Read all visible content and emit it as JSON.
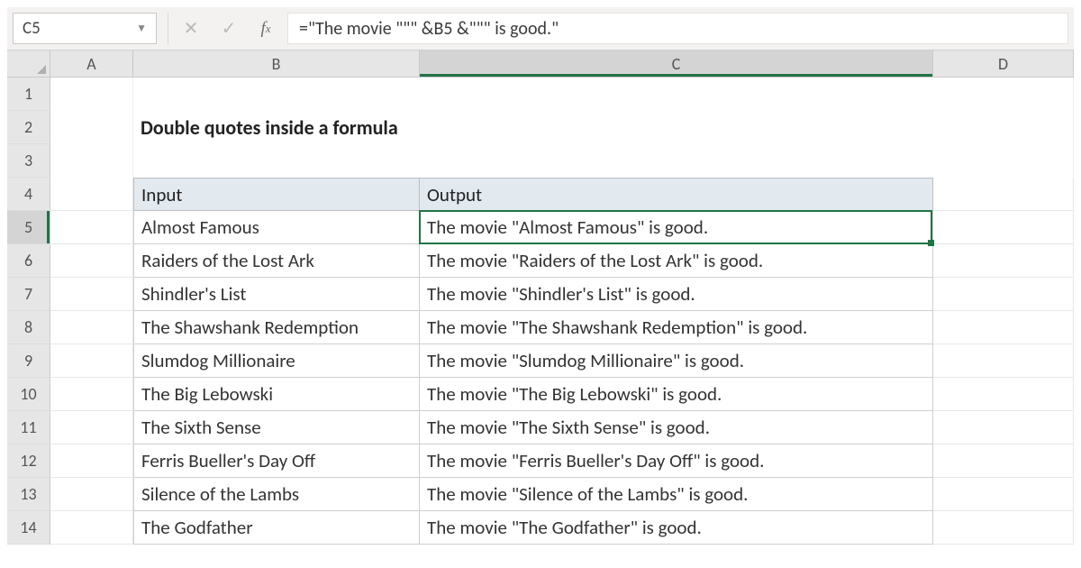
{
  "namebox": {
    "value": "C5"
  },
  "formula": "=\"The movie \"\"\" &B5 &\"\"\" is good.\"",
  "columns": [
    "A",
    "B",
    "C",
    "D"
  ],
  "activeCol": "C",
  "activeRow": "5",
  "title": "Double quotes inside a formula",
  "table": {
    "headers": {
      "input": "Input",
      "output": "Output"
    },
    "rows": [
      {
        "input": "Almost Famous",
        "output": "The movie \"Almost Famous\" is good."
      },
      {
        "input": "Raiders of the Lost Ark",
        "output": "The movie \"Raiders of the Lost Ark\" is good."
      },
      {
        "input": "Shindler's List",
        "output": "The movie \"Shindler's List\" is good."
      },
      {
        "input": "The Shawshank Redemption",
        "output": "The movie \"The Shawshank Redemption\" is good."
      },
      {
        "input": "Slumdog Millionaire",
        "output": "The movie \"Slumdog Millionaire\" is good."
      },
      {
        "input": "The Big Lebowski",
        "output": "The movie \"The Big Lebowski\" is good."
      },
      {
        "input": "The Sixth Sense",
        "output": "The movie \"The Sixth Sense\" is good."
      },
      {
        "input": "Ferris Bueller's Day Off",
        "output": "The movie \"Ferris Bueller's Day Off\" is good."
      },
      {
        "input": "Silence of the Lambs",
        "output": "The movie \"Silence of the Lambs\" is good."
      },
      {
        "input": "The Godfather",
        "output": "The movie \"The Godfather\" is good."
      }
    ]
  },
  "rowNumbers": [
    "1",
    "2",
    "3",
    "4",
    "5",
    "6",
    "7",
    "8",
    "9",
    "10",
    "11",
    "12",
    "13",
    "14"
  ]
}
